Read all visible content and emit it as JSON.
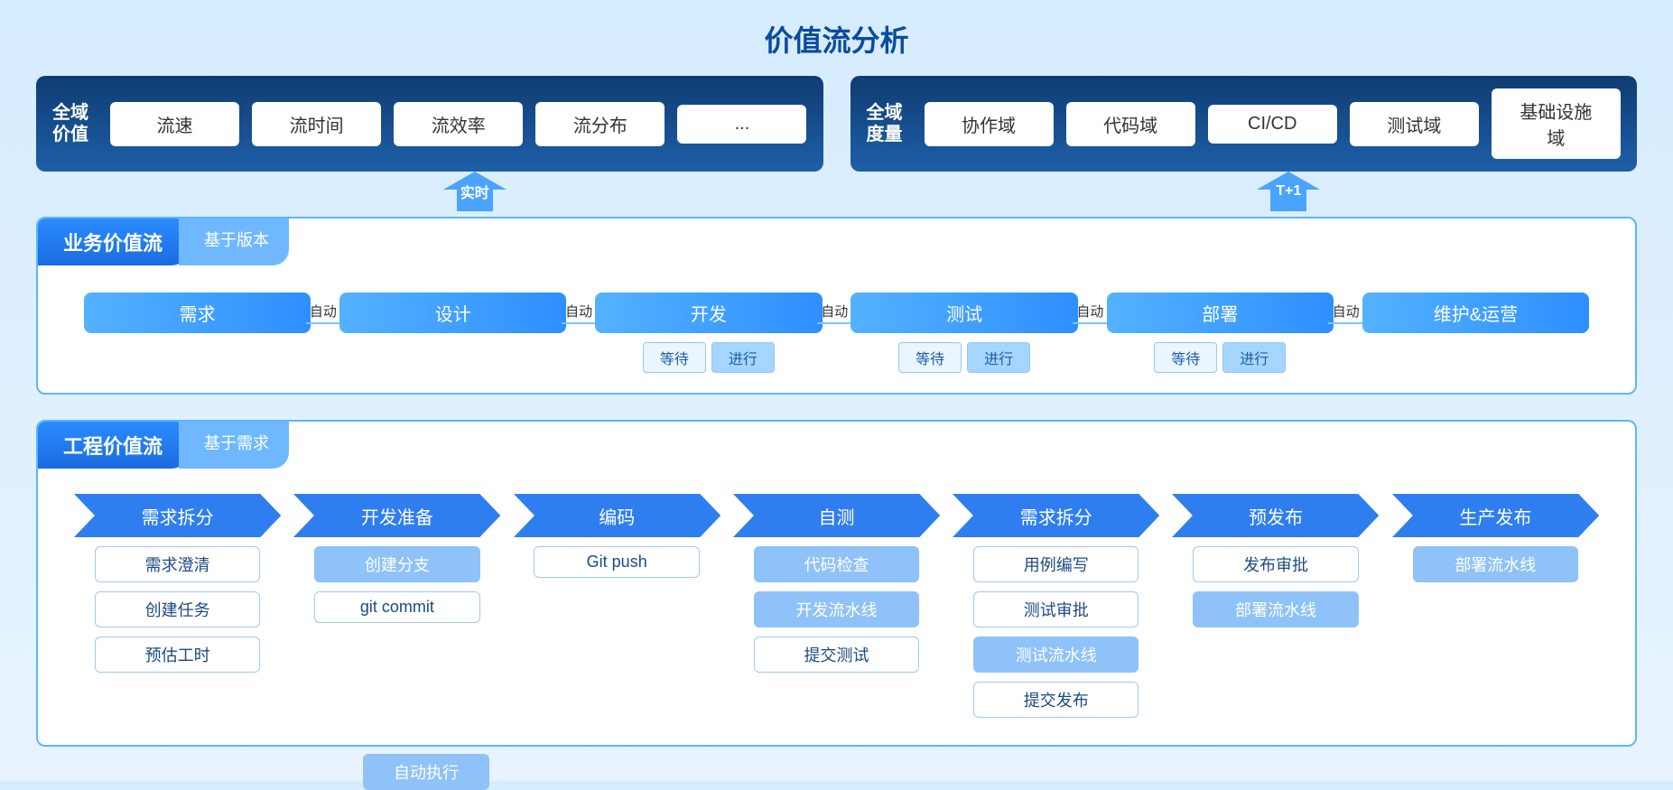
{
  "title": "价值流分析",
  "top": {
    "left": {
      "label": "全域\n价值",
      "chips": [
        "流速",
        "流时间",
        "流效率",
        "流分布",
        "..."
      ],
      "arrow": "实时"
    },
    "right": {
      "label": "全域\n度量",
      "chips": [
        "协作域",
        "代码域",
        "CI/CD",
        "测试域",
        "基础设施域"
      ],
      "arrow": "T+1"
    }
  },
  "business": {
    "title": "业务价值流",
    "subtitle": "基于版本",
    "conn_label": "自动",
    "stages": [
      {
        "name": "需求",
        "sub": null
      },
      {
        "name": "设计",
        "sub": null
      },
      {
        "name": "开发",
        "sub": [
          "等待",
          "进行"
        ]
      },
      {
        "name": "测试",
        "sub": [
          "等待",
          "进行"
        ]
      },
      {
        "name": "部署",
        "sub": [
          "等待",
          "进行"
        ]
      },
      {
        "name": "维护&运营",
        "sub": null
      }
    ]
  },
  "engineering": {
    "title": "工程价值流",
    "subtitle": "基于需求",
    "legend": "自动执行",
    "steps": [
      {
        "name": "需求拆分",
        "tasks": [
          {
            "label": "需求澄清",
            "auto": false
          },
          {
            "label": "创建任务",
            "auto": false
          },
          {
            "label": "预估工时",
            "auto": false
          }
        ]
      },
      {
        "name": "开发准备",
        "tasks": [
          {
            "label": "创建分支",
            "auto": true
          },
          {
            "label": "git commit",
            "auto": false
          }
        ]
      },
      {
        "name": "编码",
        "tasks": [
          {
            "label": "Git push",
            "auto": false
          }
        ]
      },
      {
        "name": "自测",
        "tasks": [
          {
            "label": "代码检查",
            "auto": true
          },
          {
            "label": "开发流水线",
            "auto": true
          },
          {
            "label": "提交测试",
            "auto": false
          }
        ]
      },
      {
        "name": "需求拆分",
        "tasks": [
          {
            "label": "用例编写",
            "auto": false
          },
          {
            "label": "测试审批",
            "auto": false
          },
          {
            "label": "测试流水线",
            "auto": true
          },
          {
            "label": "提交发布",
            "auto": false
          }
        ]
      },
      {
        "name": "预发布",
        "tasks": [
          {
            "label": "发布审批",
            "auto": false
          },
          {
            "label": "部署流水线",
            "auto": true
          }
        ]
      },
      {
        "name": "生产发布",
        "tasks": [
          {
            "label": "部署流水线",
            "auto": true
          }
        ]
      }
    ]
  }
}
